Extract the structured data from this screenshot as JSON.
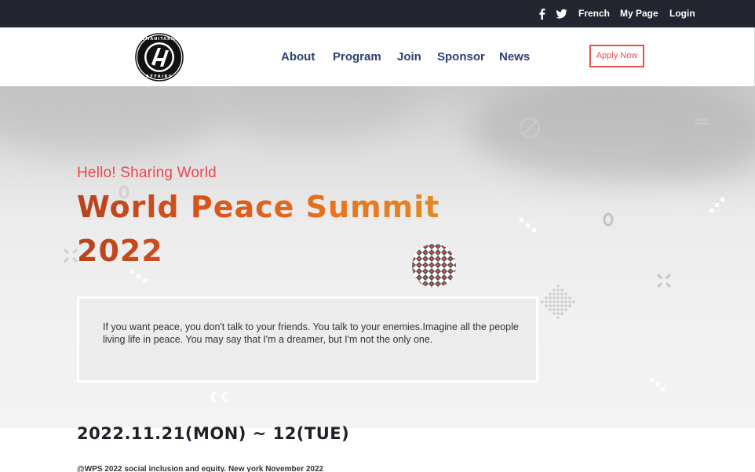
{
  "topbar": {
    "social": [
      {
        "icon": "facebook-icon"
      },
      {
        "icon": "twitter-icon"
      }
    ],
    "links": [
      "French",
      "My Page",
      "Login"
    ]
  },
  "header": {
    "logo_text": "HUMANITARIAN AFFAIRS",
    "nav": [
      "About",
      "Program",
      "Join",
      "Sponsor",
      "News"
    ],
    "apply_label": "Apply Now"
  },
  "hero": {
    "greeting": "Hello! Sharing World",
    "title_line1_a": "World Peace ",
    "title_line1_b": "Summit",
    "title_line2": "2022",
    "quote": "If you want peace, you don't talk to your friends. You talk to your enemies.Imagine all the people living life in peace. You may say that I'm a dreamer, but I'm not the only one."
  },
  "event": {
    "date": "2022.11.21(MON) ~ 12(TUE)",
    "footnote": "@WPS 2022 social inclusion and equity. New york November 2022"
  },
  "colors": {
    "topbar_bg": "#23262f",
    "nav_text": "#2c4072",
    "accent_red": "#e0534a",
    "title_orange": "#d8541b"
  }
}
